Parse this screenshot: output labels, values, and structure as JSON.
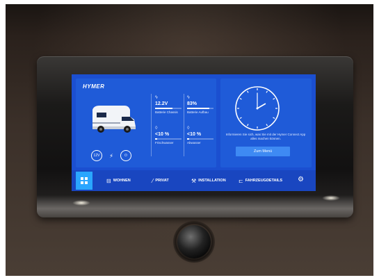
{
  "screen": {
    "brand": "HYMER",
    "vehicle_image": "camper-van",
    "status_icons": [
      "12V",
      "lightning-icon",
      "plug-icon"
    ],
    "stats": [
      {
        "icon": "lightning-icon",
        "value": "12.2V",
        "label": "Batterie Chassis",
        "level": 0.65
      },
      {
        "icon": "lightning-icon",
        "value": "83%",
        "label": "Batterie Aufbau",
        "level": 0.83
      },
      {
        "icon": "drop-icon",
        "value": "<10 %",
        "label": "Frischwasser",
        "level": 0.08
      },
      {
        "icon": "drop-icon",
        "value": "<10 %",
        "label": "Abwasser",
        "level": 0.08
      }
    ],
    "clock": {
      "hour": 2,
      "minute": 60
    },
    "info_text": "Informieren Sie sich, was Sie mit der Hymer Connect App alles machen können.",
    "menu_button": "Zum Menü",
    "nav": {
      "home_icon": "grid-icon",
      "items": [
        {
          "icon": "bed-icon",
          "label": "WOHNEN"
        },
        {
          "icon": "leaf-icon",
          "label": "PRIVAT"
        },
        {
          "icon": "tools-icon",
          "label": "INSTALLATION"
        },
        {
          "icon": "van-icon",
          "label": "FAHRZEUGDETAILS"
        }
      ],
      "settings_icon": "gear-icon"
    }
  },
  "colors": {
    "screen_blue": "#1f5bd8",
    "accent": "#2aa6ff",
    "button": "#3e8af3"
  }
}
